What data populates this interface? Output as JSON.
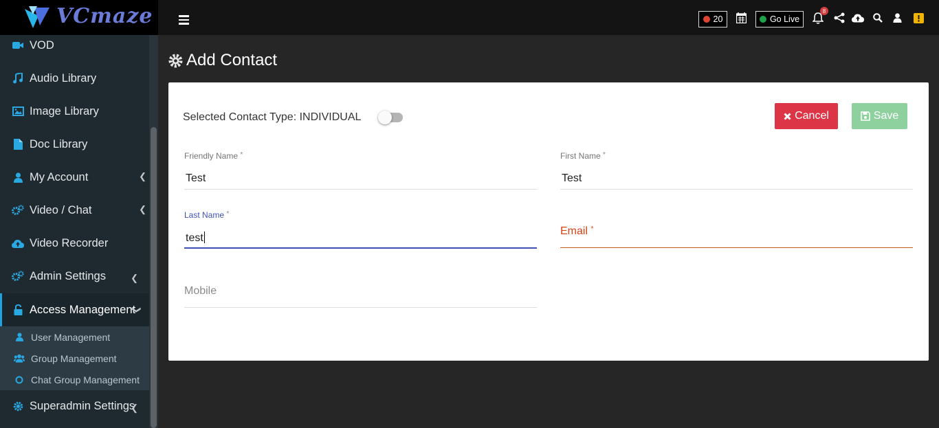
{
  "brand": {
    "name": "VCmaze"
  },
  "sidebar": {
    "items": [
      {
        "label": "VOD",
        "icon": "video-camera-icon"
      },
      {
        "label": "Audio Library",
        "icon": "music-note-icon"
      },
      {
        "label": "Image Library",
        "icon": "image-icon"
      },
      {
        "label": "Doc Library",
        "icon": "document-icon"
      },
      {
        "label": "My Account",
        "icon": "user-icon"
      },
      {
        "label": "Video / Chat",
        "icon": "gears-icon"
      },
      {
        "label": "Video Recorder",
        "icon": "cloud-upload-icon"
      },
      {
        "label": "Admin Settings",
        "icon": "gears-icon"
      },
      {
        "label": "Access Management",
        "icon": "unlock-icon"
      },
      {
        "label": "Superadmin Settings",
        "icon": "gear-icon"
      }
    ],
    "subitems": [
      {
        "label": "User Management",
        "icon": "user-icon"
      },
      {
        "label": "Group Management",
        "icon": "users-icon"
      },
      {
        "label": "Chat Group Management",
        "icon": "circle-icon"
      }
    ]
  },
  "topbar": {
    "recording_count": "20",
    "go_live_label": "Go Live",
    "notification_count": "8"
  },
  "page": {
    "title": "Add Contact"
  },
  "form": {
    "contact_type_text": "Selected Contact Type: INDIVIDUAL",
    "cancel_label": "Cancel",
    "save_label": "Save",
    "friendly_name": {
      "label": "Friendly Name",
      "value": "Test"
    },
    "first_name": {
      "label": "First Name",
      "value": "Test"
    },
    "last_name": {
      "label": "Last Name",
      "value": "test"
    },
    "email": {
      "label": "Email",
      "value": ""
    },
    "mobile": {
      "label": "Mobile",
      "value": ""
    },
    "required_mark": "*"
  },
  "colors": {
    "accent_blue": "#1fa3e0",
    "danger": "#dc3545",
    "success_light": "#8fd19e",
    "focus_blue": "#3f51b5",
    "error_red": "#d84315"
  }
}
